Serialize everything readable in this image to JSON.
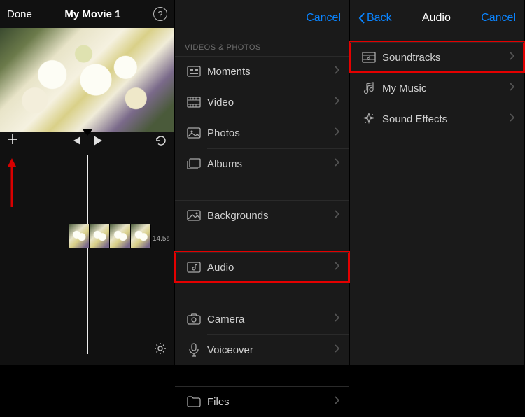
{
  "pane1": {
    "done": "Done",
    "title": "My Movie 1",
    "clip_duration": "14.5s"
  },
  "pane2": {
    "cancel": "Cancel",
    "section_header": "Videos & Photos",
    "items": {
      "moments": "Moments",
      "video": "Video",
      "photos": "Photos",
      "albums": "Albums",
      "backgrounds": "Backgrounds",
      "audio": "Audio",
      "camera": "Camera",
      "voiceover": "Voiceover",
      "files": "Files"
    }
  },
  "pane3": {
    "back": "Back",
    "title": "Audio",
    "cancel": "Cancel",
    "items": {
      "soundtracks": "Soundtracks",
      "my_music": "My Music",
      "sound_effects": "Sound Effects"
    }
  }
}
